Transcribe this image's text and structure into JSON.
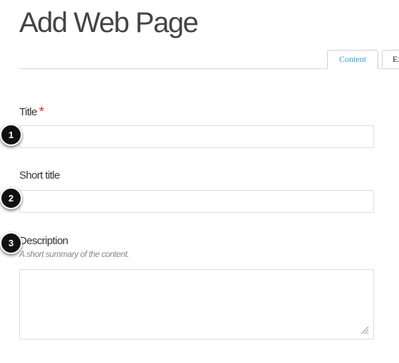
{
  "page": {
    "title": "Add Web Page"
  },
  "tabs": [
    {
      "label": "Content"
    },
    {
      "label": "Ex"
    }
  ],
  "fields": {
    "title": {
      "label": "Title",
      "required_mark": "*",
      "value": ""
    },
    "short_title": {
      "label": "Short title",
      "value": ""
    },
    "description": {
      "label": "Description",
      "help": "A short summary of the content.",
      "value": ""
    }
  },
  "markers": [
    "1",
    "2",
    "3"
  ],
  "colors": {
    "tab_active_text": "#2a9fd6",
    "required_star": "#e0322b",
    "marker_bg": "#111111"
  },
  "icons": {
    "resize_handle": "resize-handle-icon"
  }
}
